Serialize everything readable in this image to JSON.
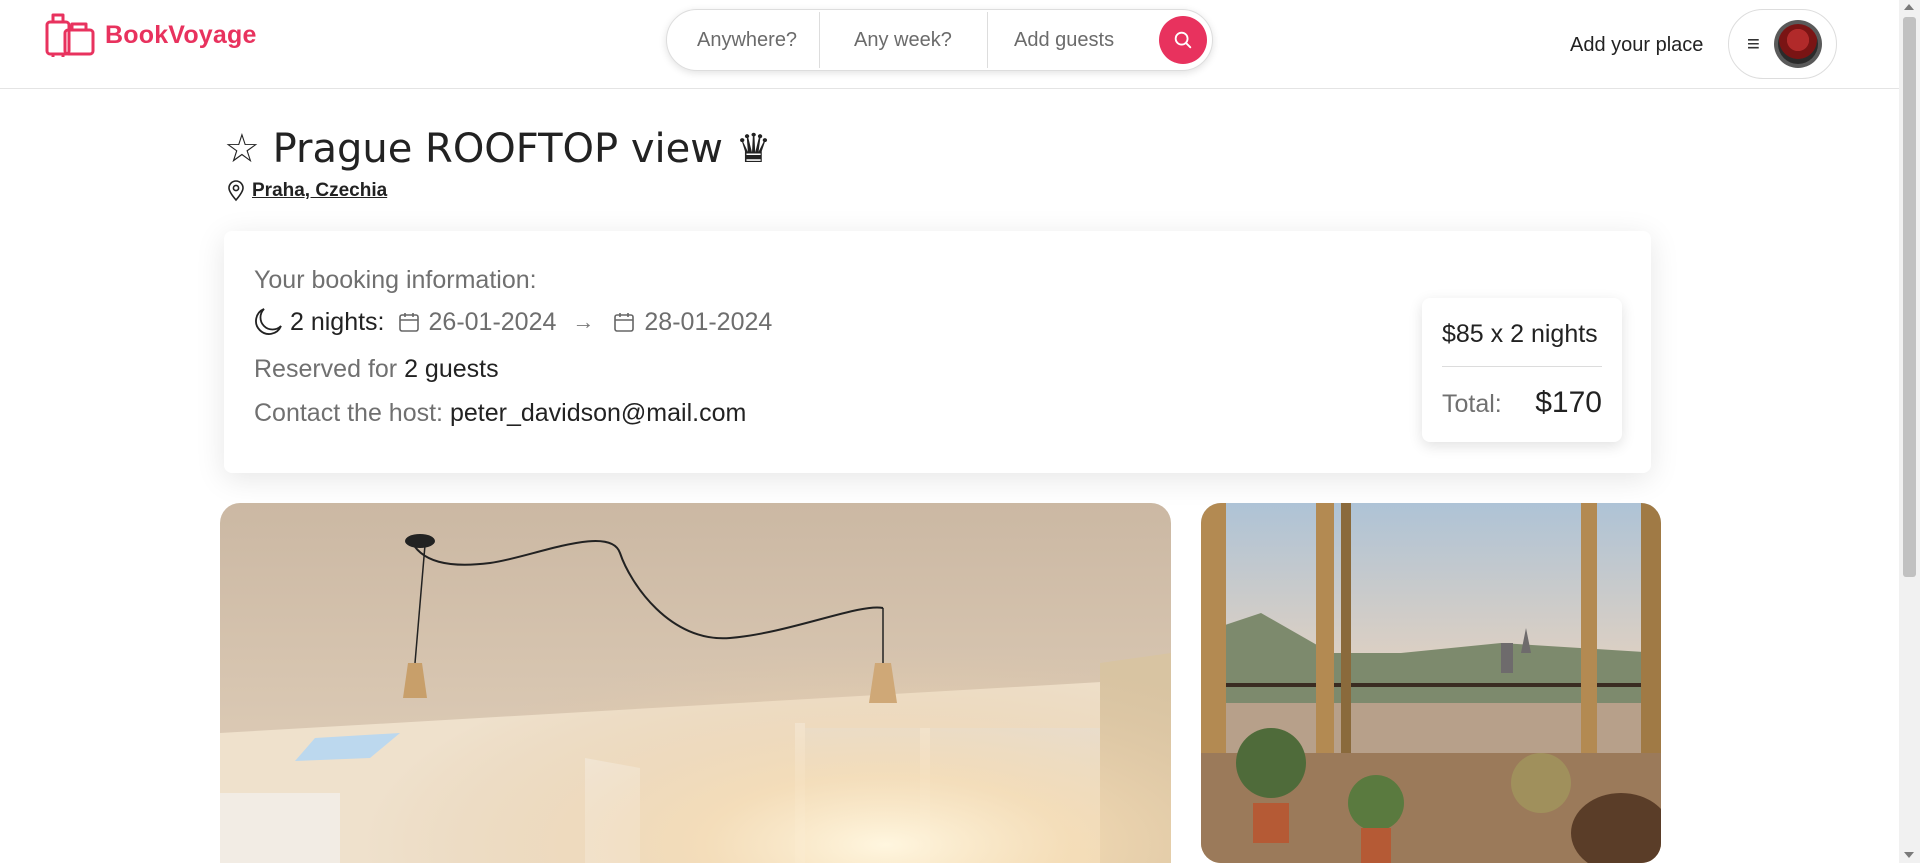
{
  "app": {
    "name": "BookVoyage",
    "brand_color": "#e8325e"
  },
  "search": {
    "anywhere": "Anywhere?",
    "week": "Any week?",
    "guests": "Add guests"
  },
  "header": {
    "add_place": "Add your place",
    "menu_icon": "≡"
  },
  "listing": {
    "title_prefix": "☆",
    "title": "Prague ROOFTOP view",
    "title_suffix": "♛",
    "location": "Praha, Czechia"
  },
  "booking": {
    "heading": "Your booking information:",
    "nights": "2 nights:",
    "check_in": "26-01-2024",
    "arrow": "→",
    "check_out": "28-01-2024",
    "reserved_label": "Reserved for",
    "guests": "2 guests",
    "contact_label": "Contact the host:",
    "contact_email": "peter_davidson@mail.com"
  },
  "price": {
    "line": "$85 x 2 nights",
    "total_label": "Total:",
    "total_value": "$170"
  }
}
